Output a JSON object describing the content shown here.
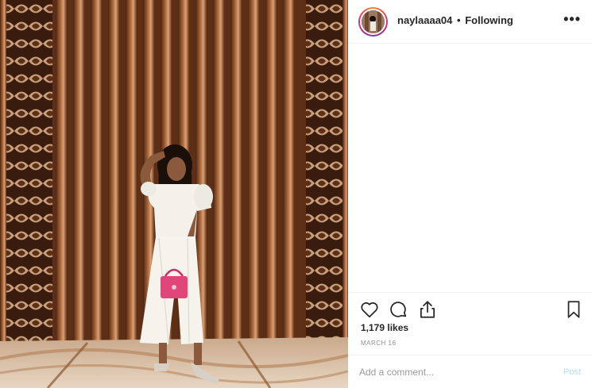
{
  "header": {
    "username": "naylaaaa04",
    "separator": "•",
    "follow_status": "Following",
    "more_label": "•••"
  },
  "photo": {
    "alt": "Woman in a white eyelet jumpsuit holding a pink handbag in front of wooden slatted wall"
  },
  "actions": {
    "like_icon": "heart-icon",
    "comment_icon": "comment-bubble-icon",
    "share_icon": "share-icon",
    "save_icon": "bookmark-icon"
  },
  "stats": {
    "likes": "1,179 likes",
    "date": "MARCH 16"
  },
  "comment_box": {
    "placeholder": "Add a comment...",
    "post_label": "Post"
  },
  "colors": {
    "post_button_disabled": "#b2dffc",
    "border": "#efefef",
    "muted_text": "#8e8e8e"
  }
}
